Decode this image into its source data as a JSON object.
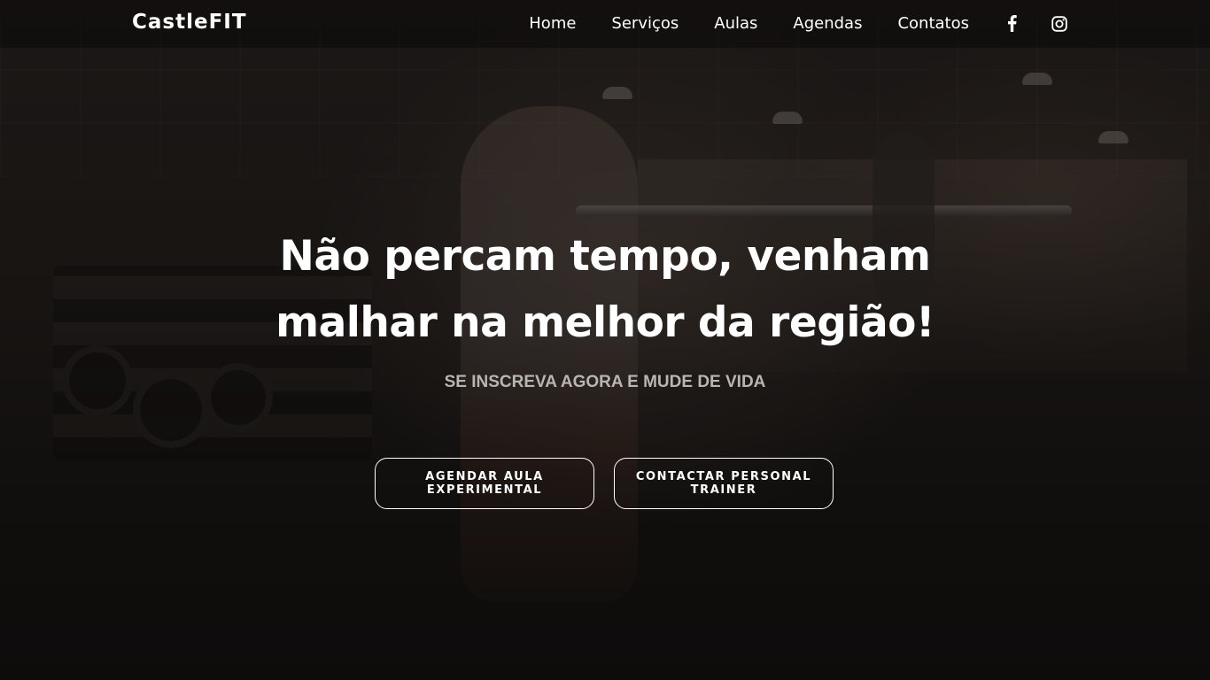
{
  "navbar": {
    "brand": "CastleFIT",
    "links": [
      {
        "label": "Home"
      },
      {
        "label": "Serviços"
      },
      {
        "label": "Aulas"
      },
      {
        "label": "Agendas"
      },
      {
        "label": "Contatos"
      }
    ],
    "social": [
      {
        "icon": "facebook-icon"
      },
      {
        "icon": "instagram-icon"
      }
    ]
  },
  "hero": {
    "headline_line1": "Não percam tempo, venham",
    "headline_line2": "malhar na melhor da região!",
    "subheadline": "SE INSCREVA AGORA E MUDE DE VIDA",
    "buttons": [
      {
        "line1": "AGENDAR AULA",
        "line2": "EXPERIMENTAL"
      },
      {
        "line1": "CONTACTAR PERSONAL",
        "line2": "TRAINER"
      }
    ]
  },
  "colors": {
    "text": "#ffffff",
    "subtext": "#b9b6b2",
    "background": "#141210"
  }
}
